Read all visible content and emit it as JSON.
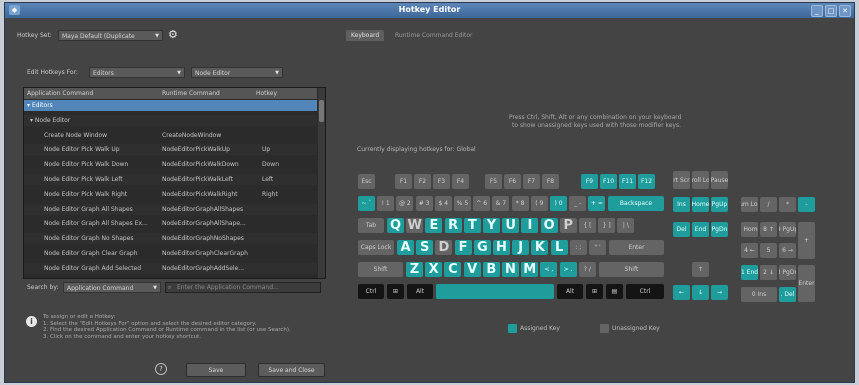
{
  "window": {
    "title": "Hotkey Editor",
    "buttons": [
      "_",
      "□",
      "✕"
    ],
    "app_icon": "app-icon"
  },
  "left": {
    "hotkey_set_label": "Hotkey Set:",
    "hotkey_set_value": "Maya Default (Duplicate",
    "edit_for_label": "Edit Hotkeys For:",
    "edit_for_value": "Editors",
    "editor_value": "Node Editor",
    "table": {
      "headers": [
        "Application Command",
        "Runtime Command",
        "Hotkey"
      ],
      "rows": [
        {
          "indent": 0,
          "cmd": "▾ Editors",
          "rt": "",
          "hk": "",
          "selected": true
        },
        {
          "indent": 1,
          "cmd": "▾ Node Editor",
          "rt": "",
          "hk": ""
        },
        {
          "indent": 2,
          "cmd": "Create Node Window",
          "rt": "CreateNodeWindow",
          "hk": ""
        },
        {
          "indent": 2,
          "cmd": "Node Editor Pick Walk Up",
          "rt": "NodeEditorPickWalkUp",
          "hk": "Up"
        },
        {
          "indent": 2,
          "cmd": "Node Editor Pick Walk Down",
          "rt": "NodeEditorPickWalkDown",
          "hk": "Down"
        },
        {
          "indent": 2,
          "cmd": "Node Editor Pick Walk Left",
          "rt": "NodeEditorPickWalkLeft",
          "hk": "Left"
        },
        {
          "indent": 2,
          "cmd": "Node Editor Pick Walk Right",
          "rt": "NodeEditorPickWalkRight",
          "hk": "Right"
        },
        {
          "indent": 2,
          "cmd": "Node Editor Graph All Shapes",
          "rt": "NodeEditorGraphAllShapes",
          "hk": ""
        },
        {
          "indent": 2,
          "cmd": "Node Editor Graph All Shapes Ex...",
          "rt": "NodeEditorGraphAllShape...",
          "hk": ""
        },
        {
          "indent": 2,
          "cmd": "Node Editor Graph No Shapes",
          "rt": "NodeEditorGraphNoShapes",
          "hk": ""
        },
        {
          "indent": 2,
          "cmd": "Node Editor Graph Clear Graph",
          "rt": "NodeEditorGraphClearGraph",
          "hk": ""
        },
        {
          "indent": 2,
          "cmd": "Node Editor Graph Add Selected",
          "rt": "NodeEditorGraphAddSele...",
          "hk": ""
        }
      ]
    },
    "search_by_label": "Search by:",
    "search_by_value": "Application Command",
    "search_placeholder": "Enter the Application Command...",
    "info": {
      "heading": "To assign or edit a Hotkey:",
      "steps": [
        "1. Select the \"Edit Hotkeys For\" option and select the desired editor category.",
        "2. Find the desired Application Command or Runtime command in the list (or use Search).",
        "3. Click on the command and enter your hotkey shortcut."
      ]
    },
    "help_icon": "?",
    "save_label": "Save",
    "save_close_label": "Save and Close"
  },
  "right": {
    "tabs": [
      "Keyboard",
      "Runtime Command Editor"
    ],
    "hint_line1": "Press Ctrl, Shift, Alt or any combination on your keyboard",
    "hint_line2": "to show unassigned keys used with those modifier keys.",
    "displaying": "Currently displaying hotkeys for: Global",
    "legend_assigned": "Assigned Key",
    "legend_unassigned": "Unassigned Key",
    "colors": {
      "assigned": "#1f9c9c",
      "unassigned": "#646464",
      "modifier": "#141414"
    },
    "keys": {
      "esc": "Esc",
      "f": [
        "F1",
        "F2",
        "F3",
        "F4",
        "F5",
        "F6",
        "F7",
        "F8",
        "F9",
        "F10",
        "F11",
        "F12"
      ],
      "prt": [
        "Prt Scrn",
        "Scroll Lock",
        "Pause"
      ],
      "num_row": [
        "~ `",
        "! 1",
        "@ 2",
        "# 3",
        "$ 4",
        "% 5",
        "^ 6",
        "& 7",
        "* 8",
        "( 9",
        ") 0",
        "_ -",
        "+ ="
      ],
      "backspace": "Backspace",
      "tab": "Tab",
      "qrow": [
        "Q",
        "W",
        "E",
        "R",
        "T",
        "Y",
        "U",
        "I",
        "O",
        "P",
        "{ [",
        "} ]",
        "| \\"
      ],
      "caps": "Caps Lock",
      "arow": [
        "A",
        "S",
        "D",
        "F",
        "G",
        "H",
        "J",
        "K",
        "L",
        ": ;",
        "\" '"
      ],
      "enter": "Enter",
      "shift": "Shift",
      "zrow": [
        "Z",
        "X",
        "C",
        "V",
        "B",
        "N",
        "M",
        "< ,",
        "> .",
        "? /"
      ],
      "ctrl": "Ctrl",
      "alt": "Alt",
      "nav1": [
        "Ins",
        "Home",
        "PgUp"
      ],
      "nav2": [
        "Del",
        "End",
        "PgDn"
      ],
      "np1": [
        "Num Lock",
        "/",
        "*",
        "-"
      ],
      "np2": [
        "7 Home",
        "8 ↑",
        "9 PgUp",
        "+"
      ],
      "np3": [
        "4 ←",
        "5",
        "6 →"
      ],
      "np4": [
        "1 End",
        "2 ↓",
        "3 PgDn",
        "Enter"
      ],
      "np5": [
        "0 Ins",
        ". Del"
      ]
    }
  }
}
